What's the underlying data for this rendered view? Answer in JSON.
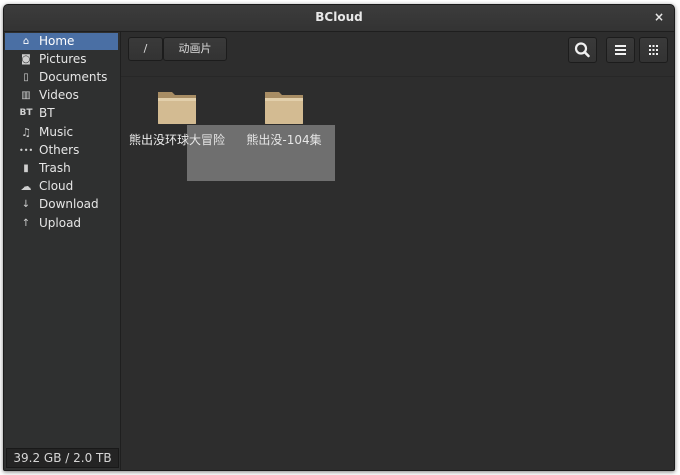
{
  "window": {
    "title": "BCloud",
    "close_glyph": "×"
  },
  "sidebar": {
    "items": [
      {
        "label": "Home",
        "icon": "home-icon",
        "glyph": "⌂",
        "active": true
      },
      {
        "label": "Pictures",
        "icon": "camera-icon",
        "glyph": "◙",
        "active": false
      },
      {
        "label": "Documents",
        "icon": "document-icon",
        "glyph": "▯",
        "active": false
      },
      {
        "label": "Videos",
        "icon": "film-icon",
        "glyph": "▥",
        "active": false
      },
      {
        "label": "BT",
        "icon": "bt-icon",
        "glyph": "BT",
        "active": false
      },
      {
        "label": "Music",
        "icon": "music-icon",
        "glyph": "♫",
        "active": false
      },
      {
        "label": "Others",
        "icon": "more-icon",
        "glyph": "•••",
        "active": false
      },
      {
        "label": "Trash",
        "icon": "trash-icon",
        "glyph": "▮",
        "active": false
      },
      {
        "label": "Cloud",
        "icon": "cloud-icon",
        "glyph": "☁",
        "active": false
      },
      {
        "label": "Download",
        "icon": "download-icon",
        "glyph": "↓",
        "active": false
      },
      {
        "label": "Upload",
        "icon": "upload-icon",
        "glyph": "↑",
        "active": false
      }
    ],
    "storage": "39.2 GB / 2.0 TB"
  },
  "toolbar": {
    "breadcrumb": [
      "/",
      "动画片"
    ],
    "buttons": [
      "search-icon",
      "list-view-icon",
      "grid-view-icon"
    ]
  },
  "files": [
    {
      "name": "熊出没环球大冒险",
      "icon": "folder-icon"
    },
    {
      "name": "熊出没-104集",
      "icon": "folder-icon"
    }
  ],
  "colors": {
    "accent": "#4a6fa4",
    "background": "#2d2d2d",
    "folder": "#cdb48a"
  }
}
